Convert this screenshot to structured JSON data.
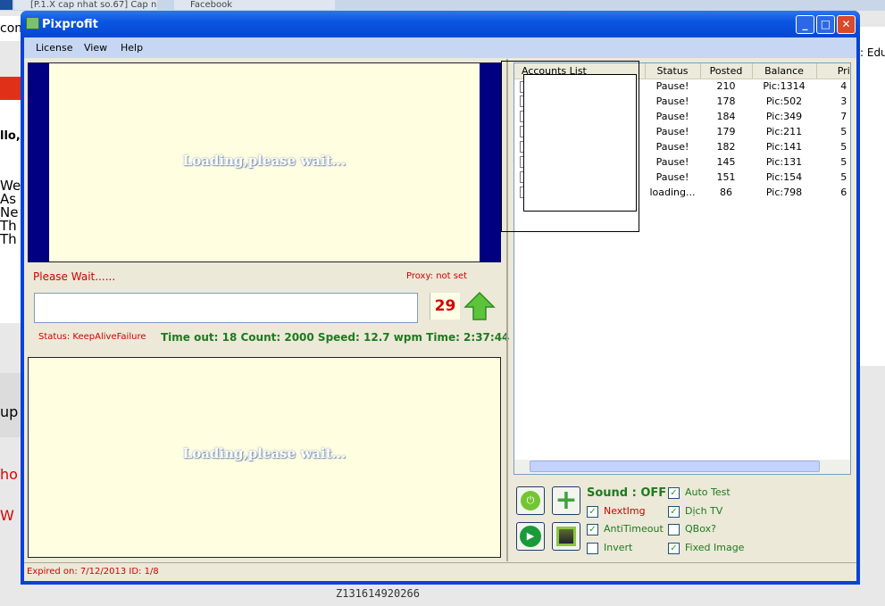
{
  "background": {
    "tabs": [
      "[P.1.X cap nhat so.67] Cap n",
      "Facebook"
    ],
    "fragments": [
      "com",
      "llo,",
      "We",
      "As",
      "Ne",
      "Th",
      "Th",
      "up",
      "ho",
      "W",
      ": Edu"
    ],
    "footer_code": "Z131614920266"
  },
  "window": {
    "title": "Pixprofit",
    "controls": [
      "minimize",
      "maximize",
      "close"
    ]
  },
  "menu": [
    "License",
    "View",
    "Help"
  ],
  "captcha": {
    "top_loading": "Loading,please wait...",
    "bottom_loading": "Loading,please wait...",
    "wait_text": "Please Wait......",
    "proxy": "Proxy: not set",
    "input_value": "",
    "countdown": "29",
    "status": "Status: KeepAliveFailure",
    "stats": "Time out: 18 Count: 2000 Speed: 12.7 wpm Time: 2:37:44"
  },
  "accounts": {
    "columns": [
      "Accounts List",
      "Status",
      "Posted",
      "Balance",
      "Pri"
    ],
    "rows": [
      {
        "status": "Pause!",
        "posted": "210",
        "balance": "Pic:1314",
        "pri": "4"
      },
      {
        "status": "Pause!",
        "posted": "178",
        "balance": "Pic:502",
        "pri": "3"
      },
      {
        "status": "Pause!",
        "posted": "184",
        "balance": "Pic:349",
        "pri": "7"
      },
      {
        "status": "Pause!",
        "posted": "179",
        "balance": "Pic:211",
        "pri": "5"
      },
      {
        "status": "Pause!",
        "posted": "182",
        "balance": "Pic:141",
        "pri": "5"
      },
      {
        "status": "Pause!",
        "posted": "145",
        "balance": "Pic:131",
        "pri": "5"
      },
      {
        "status": "Pause!",
        "posted": "151",
        "balance": "Pic:154",
        "pri": "5"
      },
      {
        "status": "loading...",
        "posted": "86",
        "balance": "Pic:798",
        "pri": "6"
      }
    ]
  },
  "controls": {
    "sound": "Sound : OFF",
    "options": [
      {
        "label": "NextImg",
        "checked": true
      },
      {
        "label": "AntiTimeout",
        "checked": true
      },
      {
        "label": "Invert",
        "checked": false
      },
      {
        "label": "Auto Test",
        "checked": true
      },
      {
        "label": "Dịch TV",
        "checked": true
      },
      {
        "label": "QBox?",
        "checked": false
      },
      {
        "label": "Fixed Image",
        "checked": true
      }
    ]
  },
  "statusbar": "Expired on: 7/12/2013  ID: 1/8"
}
